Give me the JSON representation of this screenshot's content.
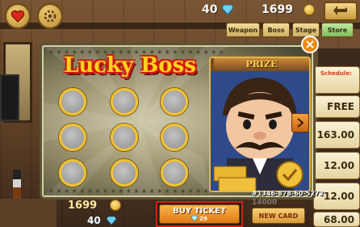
{
  "hud": {
    "gems": "40",
    "coins": "1699"
  },
  "tabs": {
    "weapon": "Weapon",
    "boss": "Boss",
    "stage": "Stage",
    "store": "Store"
  },
  "store_column": {
    "schedule": "Schedule:",
    "free": "FREE",
    "price_1": "163.00",
    "price_2": "12.00",
    "price_3": "12.00",
    "price_4": "68.00"
  },
  "dialog": {
    "title": "Lucky Boss",
    "prize_label": "PRIZE",
    "prize_id": "#1346-878-60-5272",
    "scratch_slots": 9
  },
  "bottom": {
    "coins": "1699",
    "gems": "40",
    "buy_ticket_label": "BUY TICKET",
    "buy_ticket_cost": "29",
    "new_card_label": "NEW CARD",
    "faded_value": "14000"
  },
  "colors": {
    "title_fill": "#ffd21e",
    "title_outline": "#d21a10",
    "buy_button": "#e17a14",
    "highlight_border": "#d41e10",
    "store_tab_active": "#7fbf5e"
  },
  "icons": {
    "profile": "heart-icon",
    "settings": "gear-icon",
    "back": "back-arrow-icon",
    "gem": "diamond-icon",
    "coin": "coin-icon",
    "close": "close-icon",
    "next": "chevron-right-icon"
  }
}
